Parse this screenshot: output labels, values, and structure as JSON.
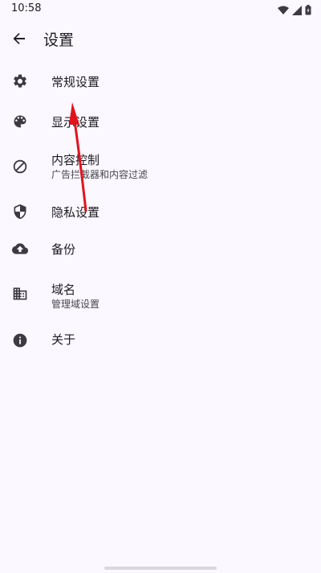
{
  "status_bar": {
    "time": "10:58"
  },
  "app_bar": {
    "title": "设置"
  },
  "settings": [
    {
      "key": "general",
      "label": "常规设置",
      "sublabel": "",
      "icon": "gear-icon"
    },
    {
      "key": "display",
      "label": "显示设置",
      "sublabel": "",
      "icon": "palette-icon"
    },
    {
      "key": "content-control",
      "label": "内容控制",
      "sublabel": "广告拦截器和内容过滤",
      "icon": "block-icon"
    },
    {
      "key": "privacy",
      "label": "隐私设置",
      "sublabel": "",
      "icon": "shield-icon"
    },
    {
      "key": "backup",
      "label": "备份",
      "sublabel": "",
      "icon": "cloud-upload-icon"
    },
    {
      "key": "domains",
      "label": "域名",
      "sublabel": "管理域设置",
      "icon": "domain-icon"
    },
    {
      "key": "about",
      "label": "关于",
      "sublabel": "",
      "icon": "info-icon"
    }
  ],
  "colors": {
    "background": "#fcf8ff",
    "text_primary": "#1c1b1f",
    "text_secondary": "#49454f",
    "icon": "#3d3a42",
    "annotation_arrow": "#e0141e"
  }
}
